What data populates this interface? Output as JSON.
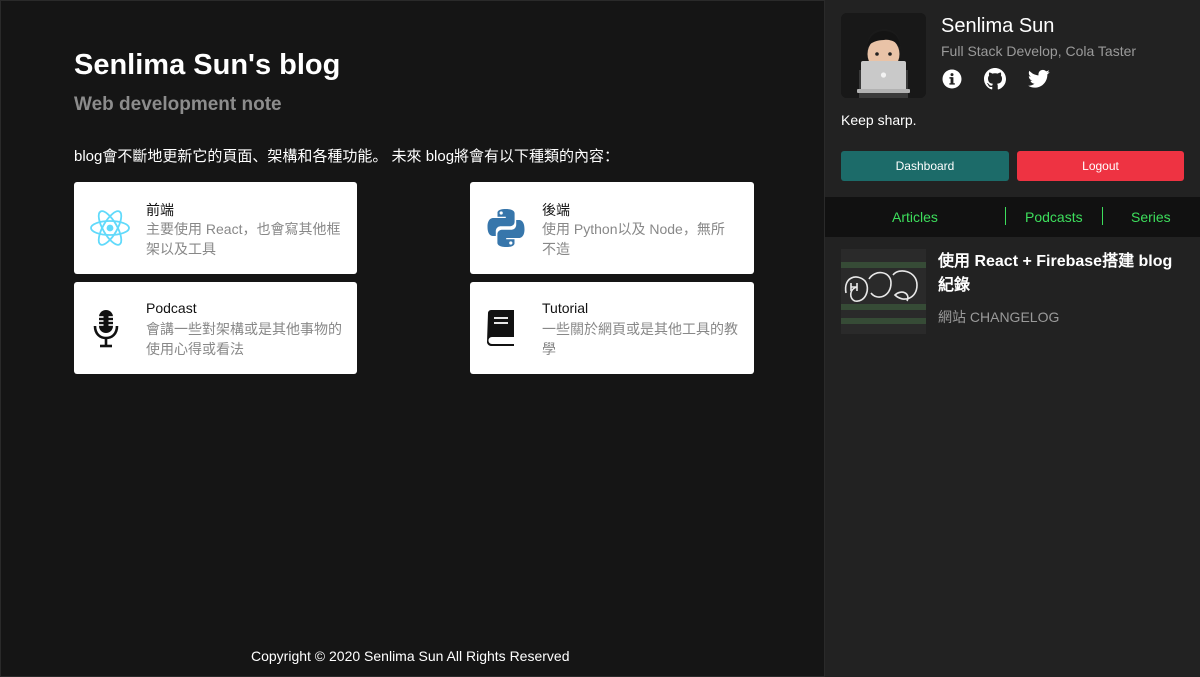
{
  "main": {
    "title": "Senlima Sun's blog",
    "subtitle": "Web development note",
    "intro": "blog會不斷地更新它的頁面、架構和各種功能。 未來 blog將會有以下種類的內容：",
    "cards": [
      {
        "title": "前端",
        "desc": "主要使用 React，也會寫其他框架以及工具",
        "icon": "react-icon",
        "icon_color": "#61dafb"
      },
      {
        "title": "後端",
        "desc": "使用 Python以及 Node，無所不造",
        "icon": "python-icon",
        "icon_color": "#3776ab"
      },
      {
        "title": "Podcast",
        "desc": "會講一些對架構或是其他事物的使用心得或看法",
        "icon": "microphone-icon",
        "icon_color": "#111111"
      },
      {
        "title": "Tutorial",
        "desc": "一些關於網頁或是其他工具的教學",
        "icon": "book-icon",
        "icon_color": "#111111"
      }
    ],
    "footer": "Copyright © 2020 Senlima Sun All Rights Reserved"
  },
  "sidebar": {
    "name": "Senlima Sun",
    "role": "Full Stack Develop, Cola Taster",
    "social": [
      "info-icon",
      "github-icon",
      "twitter-icon"
    ],
    "motto": "Keep sharp.",
    "dashboard_label": "Dashboard",
    "logout_label": "Logout",
    "tabs": [
      "Articles",
      "Podcasts",
      "Series"
    ],
    "post": {
      "title": "使用 React + Firebase搭建 blog 紀錄",
      "tag": "網站 CHANGELOG"
    }
  },
  "colors": {
    "background": "#151515",
    "sidebar": "#222222",
    "dashboard": "#1c6b69",
    "logout": "#ee3342",
    "tab_accent": "#3dde5c"
  }
}
